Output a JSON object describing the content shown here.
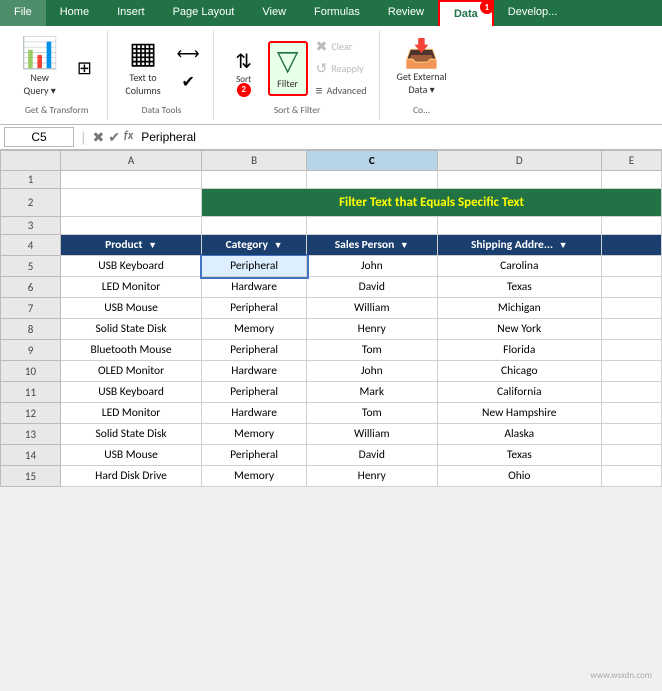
{
  "ribbon": {
    "tabs": [
      {
        "label": "File",
        "active": false
      },
      {
        "label": "Home",
        "active": false
      },
      {
        "label": "Insert",
        "active": false
      },
      {
        "label": "Page Layout",
        "active": false
      },
      {
        "label": "View",
        "active": false
      },
      {
        "label": "Formulas",
        "active": false
      },
      {
        "label": "Review",
        "active": false
      },
      {
        "label": "Data",
        "active": true
      },
      {
        "label": "Develop...",
        "active": false
      }
    ],
    "groups": {
      "get_transform": {
        "label": "Get & Transform",
        "buttons": [
          {
            "label": "New\nQuery",
            "icon": "📊"
          },
          {
            "label": "",
            "icon": "⊞"
          }
        ]
      },
      "data_tools": {
        "label": "Data Tools",
        "buttons": [
          {
            "label": "Text to\nColumns",
            "icon": "▦"
          },
          {
            "label": "",
            "icon": "⟷"
          },
          {
            "label": "",
            "icon": "✔"
          }
        ]
      },
      "sort_filter": {
        "label": "Sort & Filter",
        "buttons": [
          {
            "label": "Sort",
            "icon": "↕"
          },
          {
            "label": "Filter",
            "icon": "🔽",
            "highlighted": true
          },
          {
            "label": "Clear",
            "icon": "✖",
            "disabled": true
          },
          {
            "label": "Reapply",
            "icon": "↺",
            "disabled": true
          },
          {
            "label": "Advanced",
            "icon": "≡"
          }
        ]
      },
      "external_data": {
        "label": "Co...",
        "buttons": [
          {
            "label": "Get External\nData",
            "icon": "📥"
          }
        ]
      }
    }
  },
  "formula_bar": {
    "cell_ref": "C5",
    "formula": "Peripheral",
    "icons": [
      "✖",
      "✔",
      "fx"
    ]
  },
  "spreadsheet": {
    "title": "Filter Text that Equals Specific Text",
    "col_headers": [
      "A",
      "B",
      "C",
      "D",
      "E"
    ],
    "selected_col": "C",
    "headers": [
      "Product",
      "Category",
      "Sales Person",
      "Shipping Addre..."
    ],
    "rows": [
      {
        "num": 1,
        "cells": [
          "",
          "",
          "",
          "",
          ""
        ]
      },
      {
        "num": 2,
        "cells": [
          "title",
          "",
          "",
          "",
          ""
        ]
      },
      {
        "num": 3,
        "cells": [
          "",
          "",
          "",
          "",
          ""
        ]
      },
      {
        "num": 4,
        "cells": [
          "header",
          "header",
          "header",
          "header",
          "header"
        ]
      },
      {
        "num": 5,
        "cells": [
          "USB Keyboard",
          "Peripheral",
          "John",
          "Carolina"
        ]
      },
      {
        "num": 6,
        "cells": [
          "LED Monitor",
          "Hardware",
          "David",
          "Texas"
        ]
      },
      {
        "num": 7,
        "cells": [
          "USB Mouse",
          "Peripheral",
          "William",
          "Michigan"
        ]
      },
      {
        "num": 8,
        "cells": [
          "Solid State Disk",
          "Memory",
          "Henry",
          "New York"
        ]
      },
      {
        "num": 9,
        "cells": [
          "Bluetooth Mouse",
          "Peripheral",
          "Tom",
          "Florida"
        ]
      },
      {
        "num": 10,
        "cells": [
          "OLED Monitor",
          "Hardware",
          "John",
          "Chicago"
        ]
      },
      {
        "num": 11,
        "cells": [
          "USB Keyboard",
          "Peripheral",
          "Mark",
          "California"
        ]
      },
      {
        "num": 12,
        "cells": [
          "LED Monitor",
          "Hardware",
          "Tom",
          "New Hampshire"
        ]
      },
      {
        "num": 13,
        "cells": [
          "Solid State Disk",
          "Memory",
          "William",
          "Alaska"
        ]
      },
      {
        "num": 14,
        "cells": [
          "USB Mouse",
          "Peripheral",
          "David",
          "Texas"
        ]
      },
      {
        "num": 15,
        "cells": [
          "Hard Disk Drive",
          "Memory",
          "Henry",
          "Ohio"
        ]
      }
    ]
  },
  "callouts": {
    "one": "1",
    "two": "2"
  },
  "watermark": "www.wsxdn.com"
}
